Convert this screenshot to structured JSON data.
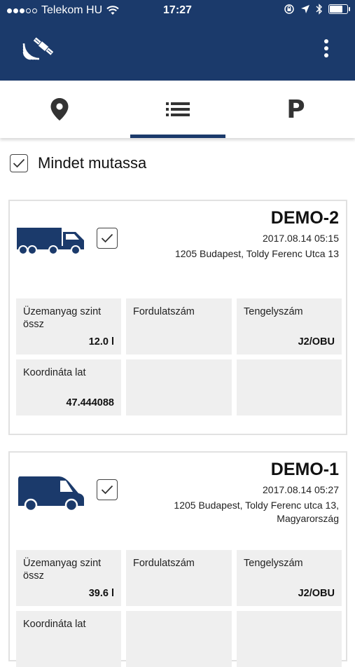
{
  "status_bar": {
    "carrier": "Telekom HU",
    "time": "17:27",
    "signal_dots": [
      true,
      true,
      true,
      false,
      false
    ],
    "battery_level": 0.85
  },
  "app_bar": {
    "logo_icon": "satellite-signal-icon",
    "menu_icon": "more-vertical-icon"
  },
  "tabs": [
    {
      "id": "map",
      "icon": "location-pin-icon",
      "active": false
    },
    {
      "id": "list",
      "icon": "list-icon",
      "active": true
    },
    {
      "id": "parking",
      "label": "P",
      "active": false
    }
  ],
  "show_all": {
    "label": "Mindet mutassa",
    "checked": true
  },
  "vehicles": [
    {
      "name": "DEMO-2",
      "type_icon": "truck-icon",
      "datetime": "2017.08.14 05:15",
      "address": "1205 Budapest, Toldy Ferenc Utca 13",
      "checked": true,
      "cells": [
        {
          "label": "Üzemanyag szint össz",
          "value": "12.0 l"
        },
        {
          "label": "Fordulatszám",
          "value": ""
        },
        {
          "label": "Tengelyszám",
          "value": "J2/OBU"
        },
        {
          "label": "Koordináta lat",
          "value": "47.444088"
        },
        {
          "label": "",
          "value": ""
        },
        {
          "label": "",
          "value": ""
        }
      ]
    },
    {
      "name": "DEMO-1",
      "type_icon": "van-icon",
      "datetime": "2017.08.14 05:27",
      "address": "1205 Budapest, Toldy Ferenc utca 13, Magyarország",
      "checked": true,
      "cells": [
        {
          "label": "Üzemanyag szint össz",
          "value": "39.6 l"
        },
        {
          "label": "Fordulatszám",
          "value": ""
        },
        {
          "label": "Tengelyszám",
          "value": "J2/OBU"
        },
        {
          "label": "Koordináta lat",
          "value": ""
        },
        {
          "label": "",
          "value": ""
        },
        {
          "label": "",
          "value": ""
        }
      ]
    }
  ],
  "colors": {
    "primary": "#1b3a6b",
    "cell_bg": "#efefef",
    "card_border": "#e1e1e1"
  }
}
